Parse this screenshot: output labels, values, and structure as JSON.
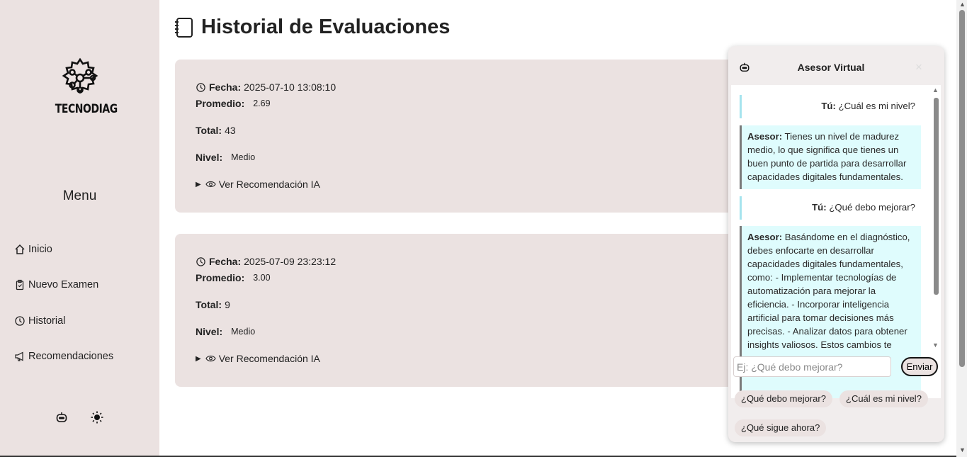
{
  "app": {
    "logo_text": "TECNODIAG",
    "menu_title": "Menu"
  },
  "nav": [
    {
      "label": "Inicio",
      "icon": "home-icon"
    },
    {
      "label": "Nuevo Examen",
      "icon": "clipboard-icon"
    },
    {
      "label": "Historial",
      "icon": "clock-icon"
    },
    {
      "label": "Recomendaciones",
      "icon": "megaphone-icon"
    }
  ],
  "tools": {
    "bot_icon": "robot-icon",
    "theme_icon": "sun-icon"
  },
  "page": {
    "title": "Historial de Evaluaciones",
    "icon": "notebook-icon"
  },
  "evaluations": [
    {
      "fecha_label": "Fecha:",
      "fecha": "2025-07-10 13:08:10",
      "promedio_label": "Promedio:",
      "promedio": "2.69",
      "total_label": "Total:",
      "total": "43",
      "nivel_label": "Nivel:",
      "nivel": "Medio",
      "toggle_label": "Ver Recomendación IA"
    },
    {
      "fecha_label": "Fecha:",
      "fecha": "2025-07-09 23:23:12",
      "promedio_label": "Promedio:",
      "promedio": "3.00",
      "total_label": "Total:",
      "total": "9",
      "nivel_label": "Nivel:",
      "nivel": "Medio",
      "toggle_label": "Ver Recomendación IA"
    }
  ],
  "chat": {
    "title": "Asesor Virtual",
    "close": "×",
    "messages": [
      {
        "role": "user",
        "speaker": "Tú:",
        "text": "¿Cuál es mi nivel?"
      },
      {
        "role": "bot",
        "speaker": "Asesor:",
        "text": "Tienes un nivel de madurez medio, lo que significa que tienes un buen punto de partida para desarrollar capacidades digitales fundamentales."
      },
      {
        "role": "user",
        "speaker": "Tú:",
        "text": "¿Qué debo mejorar?"
      },
      {
        "role": "bot",
        "speaker": "Asesor:",
        "text": "Basándome en el diagnóstico, debes enfocarte en desarrollar capacidades digitales fundamentales, como: - Implementar tecnologías de automatización para mejorar la eficiencia. - Incorporar inteligencia artificial para tomar decisiones más precisas. - Analizar datos para obtener insights valiosos. Estos cambios te"
      }
    ],
    "input_placeholder": "Ej: ¿Qué debo mejorar?",
    "input_value": "",
    "send_label": "Enviar",
    "suggestions": [
      "¿Qué debo mejorar?",
      "¿Cuál es mi nivel?",
      "¿Qué sigue ahora?"
    ]
  },
  "colors": {
    "sidebar_bg": "#ebe2e1",
    "card_bg": "#ebe2e1",
    "bot_bubble_bg": "#dffcfd",
    "user_border": "#a6e4ee"
  }
}
